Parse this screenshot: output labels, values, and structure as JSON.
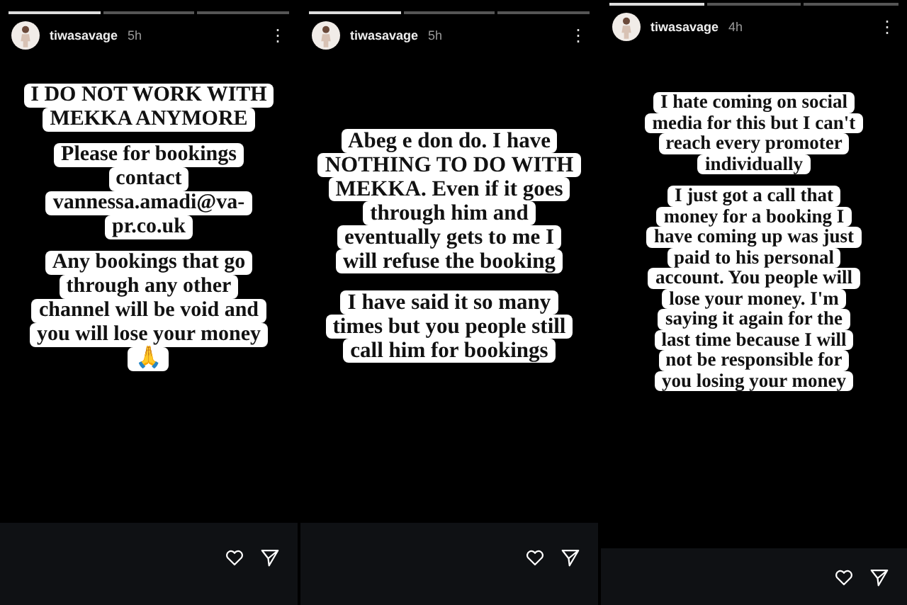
{
  "stories": [
    {
      "progress": [
        {
          "viewed": true
        },
        {
          "viewed": false
        },
        {
          "viewed": false
        }
      ],
      "username": "tiwasavage",
      "time": "5h",
      "menu": "⋮",
      "blocks": [
        {
          "lines": [
            "I DO NOT WORK WITH",
            "MEKKA ANYMORE"
          ]
        },
        {
          "lines": [
            "Please for bookings",
            "contact",
            "vannessa.amadi@va-",
            "pr.co.uk"
          ]
        },
        {
          "lines": [
            "Any bookings that go",
            "through any other",
            "channel will be void and",
            "you will lose your money",
            "🙏"
          ]
        }
      ]
    },
    {
      "progress": [
        {
          "viewed": true
        },
        {
          "viewed": false
        },
        {
          "viewed": false
        }
      ],
      "username": "tiwasavage",
      "time": "5h",
      "menu": "⋮",
      "blocks": [
        {
          "lines": [
            "Abeg e don do. I have",
            "NOTHING TO DO WITH",
            "MEKKA. Even if it goes",
            "through him and",
            "eventually gets to me I",
            "will refuse the booking"
          ]
        },
        {
          "lines": [
            "I have said it so many",
            "times but you people still",
            "call him for bookings"
          ]
        }
      ]
    },
    {
      "progress": [
        {
          "viewed": true
        },
        {
          "viewed": false
        },
        {
          "viewed": false
        }
      ],
      "username": "tiwasavage",
      "time": "4h",
      "menu": "⋮",
      "blocks": [
        {
          "lines": [
            "I hate coming on social",
            "media for this but I can't",
            "reach every promoter",
            "individually"
          ]
        },
        {
          "lines": [
            "I just got a call that",
            "money for a booking I",
            "have coming up was just",
            "paid to his personal",
            "account. You people will",
            "lose your money. I'm",
            "saying it again for the",
            "last time because I will",
            "not be responsible for",
            "you losing your money"
          ]
        }
      ]
    }
  ]
}
